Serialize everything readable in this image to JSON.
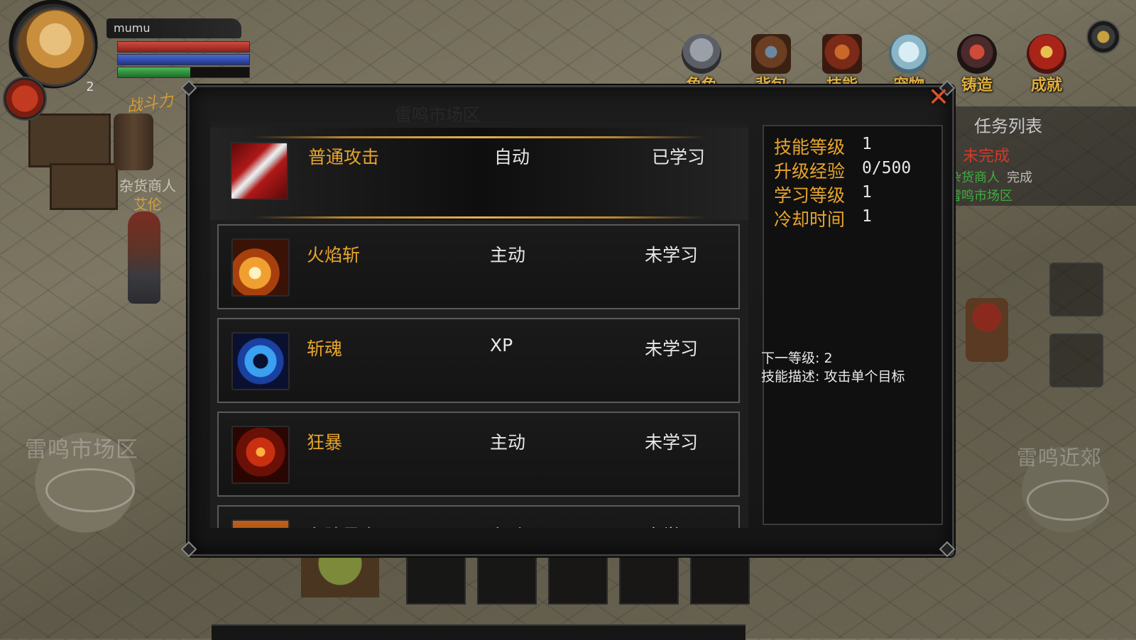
{
  "player": {
    "name": "mumu",
    "level": "2",
    "power_label": "战斗力",
    "hp_ratio": 1.0,
    "mp_ratio": 1.0,
    "xp_ratio": 0.55
  },
  "top_menu": [
    {
      "label": "角色",
      "icon": "helmet-icon"
    },
    {
      "label": "背包",
      "icon": "bag-icon"
    },
    {
      "label": "技能",
      "icon": "skill-book-icon"
    },
    {
      "label": "宠物",
      "icon": "pet-icon"
    },
    {
      "label": "铸造",
      "icon": "forge-icon"
    },
    {
      "label": "成就",
      "icon": "achievement-icon"
    }
  ],
  "scene": {
    "npc_name": "杂货商人",
    "npc_subname": "艾伦",
    "zone_left": "雷鸣市场区",
    "zone_right": "雷鸣近郊",
    "dialog_watermark": "雷鸣市场区"
  },
  "quest_panel": {
    "title": "任务列表",
    "status_incomplete": "未完成",
    "status_complete": "完成",
    "green_line_1": "杂货商人",
    "green_line_2": "雷鸣市场区"
  },
  "skills": [
    {
      "name": "普通攻击",
      "type": "自动",
      "status": "已学习",
      "icon": "slash-icon",
      "selected": true
    },
    {
      "name": "火焰斩",
      "type": "主动",
      "status": "未学习",
      "icon": "flame-slash-icon",
      "selected": false
    },
    {
      "name": "斩魂",
      "type": "XP",
      "status": "未学习",
      "icon": "soul-blade-icon",
      "selected": false
    },
    {
      "name": "狂暴",
      "type": "主动",
      "status": "未学习",
      "icon": "berserk-icon",
      "selected": false
    },
    {
      "name": "名阶暴击",
      "type": "主动",
      "status": "未学习",
      "icon": "crit-icon",
      "selected": false
    }
  ],
  "detail": {
    "skill_level_label": "技能等级",
    "skill_level_value": "1",
    "upgrade_exp_label": "升级经验",
    "upgrade_exp_value": "0/500",
    "learn_level_label": "学习等级",
    "learn_level_value": "1",
    "cooldown_label": "冷却时间",
    "cooldown_value": "1",
    "next_level": "下一等级: 2",
    "description": "技能描述: 攻击单个目标"
  },
  "colors": {
    "accent_gold": "#e8a52c",
    "status_red": "#d23a2a",
    "hp_red": "#b3302a",
    "mp_blue": "#2f4fb0",
    "xp_green": "#2f9a3a"
  }
}
